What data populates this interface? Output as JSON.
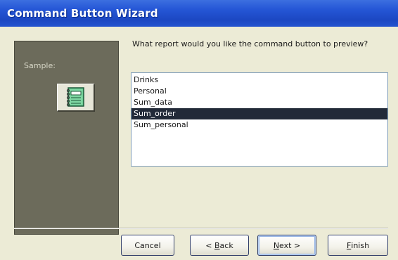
{
  "window": {
    "title": "Command Button Wizard"
  },
  "sample": {
    "label": "Sample:",
    "icon": "report-notebook-icon"
  },
  "prompt": {
    "question": "What report would you like the command button to preview?"
  },
  "list": {
    "items": [
      "Drinks",
      "Personal",
      "Sum_data",
      "Sum_order",
      "Sum_personal"
    ],
    "selected": "Sum_order"
  },
  "buttons": {
    "cancel": "Cancel",
    "back": {
      "mnemonic": "B",
      "prefix": "< ",
      "rest": "ack"
    },
    "next": {
      "mnemonic": "N",
      "rest": "ext >"
    },
    "finish": {
      "mnemonic": "F",
      "rest": "inish"
    }
  },
  "colors": {
    "title_bar": "#2556d6",
    "sample_panel": "#6c6b5b",
    "selection": "#222a38"
  }
}
